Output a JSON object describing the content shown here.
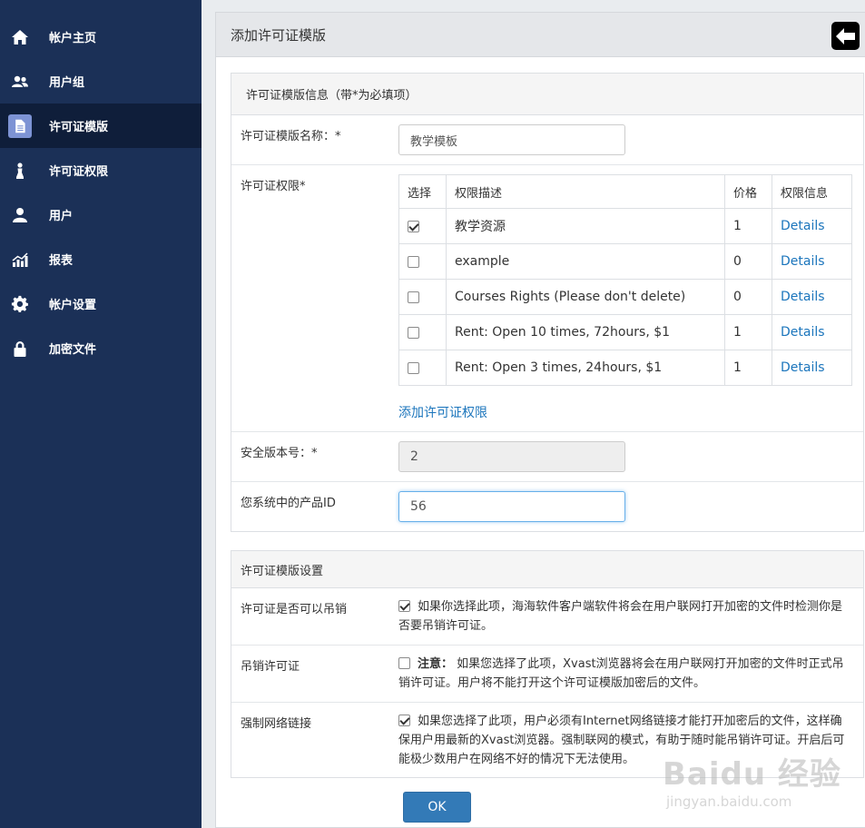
{
  "sidebar": {
    "items": [
      {
        "label": "帐户主页",
        "icon": "home-icon"
      },
      {
        "label": "用户组",
        "icon": "user-group-icon"
      },
      {
        "label": "许可证模版",
        "icon": "document-icon"
      },
      {
        "label": "许可证权限",
        "icon": "chess-pawn-icon"
      },
      {
        "label": "用户",
        "icon": "user-icon"
      },
      {
        "label": "报表",
        "icon": "bar-chart-icon"
      },
      {
        "label": "帐户设置",
        "icon": "gear-icon"
      },
      {
        "label": "加密文件",
        "icon": "lock-icon"
      }
    ],
    "active_index": 2
  },
  "header": {
    "title": "添加许可证模版",
    "back_icon": "arrow-left-icon"
  },
  "info_section": {
    "title": "许可证模版信息（带*为必填项）",
    "name_label": "许可证模版名称：*",
    "name_value": "教学模板",
    "perm_label": "许可证权限*",
    "table": {
      "headers": [
        "选择",
        "权限描述",
        "价格",
        "权限信息"
      ],
      "rows": [
        {
          "checked": true,
          "desc": "教学资源",
          "price": "1",
          "info": "Details"
        },
        {
          "checked": false,
          "desc": "example",
          "price": "0",
          "info": "Details"
        },
        {
          "checked": false,
          "desc": "Courses Rights (Please don't delete)",
          "price": "0",
          "info": "Details"
        },
        {
          "checked": false,
          "desc": "Rent: Open 10 times, 72hours, $1",
          "price": "1",
          "info": "Details"
        },
        {
          "checked": false,
          "desc": "Rent: Open 3 times, 24hours, $1",
          "price": "1",
          "info": "Details"
        }
      ]
    },
    "add_perm_link": "添加许可证权限",
    "security_label": "安全版本号：*",
    "security_value": "2",
    "product_label": "您系统中的产品ID",
    "product_value": "56"
  },
  "settings_section": {
    "title": "许可证模版设置",
    "revocable": {
      "label": "许可证是否可以吊销",
      "checked": true,
      "text": "如果你选择此项，海海软件客户端软件将会在用户联网打开加密的文件时检测你是否要吊销许可证。"
    },
    "revoke": {
      "label": "吊销许可证",
      "checked": false,
      "note_label": "注意：",
      "text": "如果您选择了此项，Xvast浏览器将会在用户联网打开加密的文件时正式吊销许可证。用户将不能打开这个许可证模版加密后的文件。"
    },
    "force_network": {
      "label": "强制网络链接",
      "checked": true,
      "text": "如果您选择了此项，用户必须有Internet网络链接才能打开加密后的文件，这样确保用户用最新的Xvast浏览器。强制联网的模式，有助于随时能吊销许可证。开启后可能极少数用户在网络不好的情况下无法使用。"
    }
  },
  "ok_button": "OK",
  "watermark": {
    "main": "Baidu 经验",
    "sub": "jingyan.baidu.com"
  }
}
